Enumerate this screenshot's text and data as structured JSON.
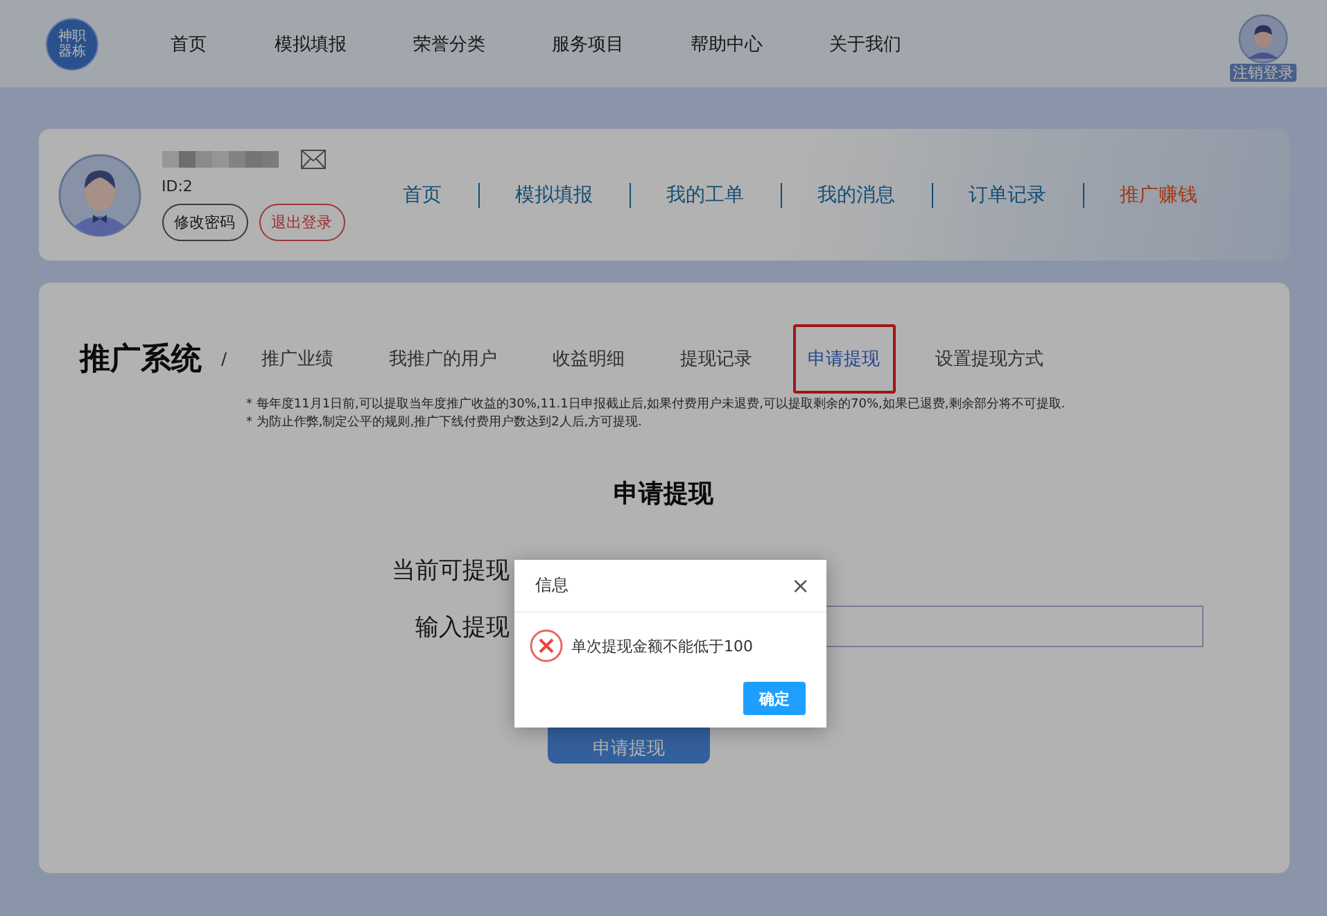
{
  "top_nav": {
    "logo_lines": [
      "神职",
      "器栋"
    ],
    "items": [
      {
        "label": "首页"
      },
      {
        "label": "模拟填报"
      },
      {
        "label": "荣誉分类"
      },
      {
        "label": "服务项目"
      },
      {
        "label": "帮助中心"
      },
      {
        "label": "关于我们"
      }
    ],
    "account_label": "注销登录"
  },
  "profile": {
    "id_text": "ID:2",
    "buttons": [
      {
        "label": "修改密码",
        "kind": "plain"
      },
      {
        "label": "退出登录",
        "kind": "danger"
      }
    ],
    "links": [
      {
        "label": "首页",
        "selected": false
      },
      {
        "label": "模拟填报",
        "selected": false
      },
      {
        "label": "我的工单",
        "selected": false
      },
      {
        "label": "我的消息",
        "selected": false
      },
      {
        "label": "订单记录",
        "selected": false
      },
      {
        "label": "推广赚钱",
        "selected": true
      }
    ]
  },
  "section": {
    "title": "推广系统",
    "separator": "/",
    "tabs": [
      {
        "label": "推广业绩",
        "selected": false,
        "highlighted": false
      },
      {
        "label": "我推广的用户",
        "selected": false,
        "highlighted": false
      },
      {
        "label": "收益明细",
        "selected": false,
        "highlighted": false
      },
      {
        "label": "提现记录",
        "selected": false,
        "highlighted": false
      },
      {
        "label": "申请提现",
        "selected": true,
        "highlighted": true
      },
      {
        "label": "设置提现方式",
        "selected": false,
        "highlighted": false
      }
    ],
    "notes": [
      "* 每年度11月1日前,可以提取当年度推广收益的30%,11.1日申报截止后,如果付费用户未退费,可以提取剩余的70%,如果已退费,剩余部分将不可提取.",
      "* 为防止作弊,制定公平的规则,推广下线付费用户数达到2人后,方可提现."
    ]
  },
  "form": {
    "heading": "申请提现",
    "available_label": "当前可提现",
    "amount_label": "输入提现",
    "submit": "申请提现"
  },
  "dialog": {
    "title": "信息",
    "close": "×",
    "message": "单次提现金额不能低于100",
    "confirm": "确定"
  }
}
